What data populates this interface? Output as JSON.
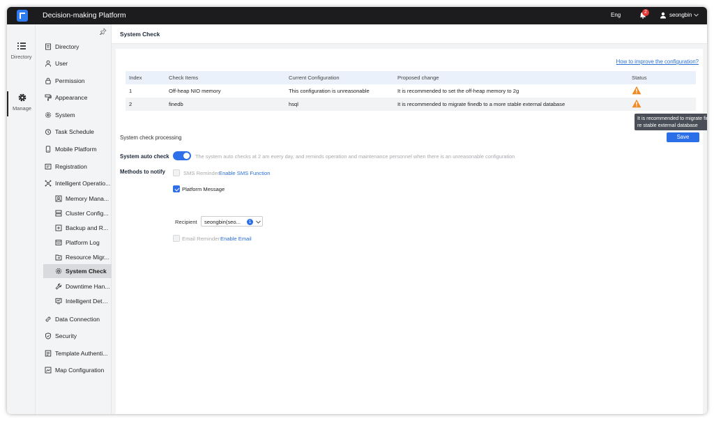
{
  "app": {
    "title": "Decision-making Platform",
    "language": "Eng",
    "notification_count": "2",
    "username": "seongbin"
  },
  "rail": {
    "items": [
      {
        "label": "Directory",
        "icon": "list-icon"
      },
      {
        "label": "Manage",
        "icon": "gear-icon",
        "active": true
      }
    ]
  },
  "nav": {
    "items": [
      {
        "label": "Directory",
        "icon": "book-icon"
      },
      {
        "label": "User",
        "icon": "user-icon"
      },
      {
        "label": "Permission",
        "icon": "lock-icon"
      },
      {
        "label": "Appearance",
        "icon": "paint-icon"
      },
      {
        "label": "System",
        "icon": "gear-icon"
      },
      {
        "label": "Task Schedule",
        "icon": "clock-icon"
      },
      {
        "label": "Mobile Platform",
        "icon": "mobile-icon"
      },
      {
        "label": "Registration",
        "icon": "registration-icon"
      },
      {
        "label": "Intelligent Operatio...",
        "icon": "network-icon"
      }
    ],
    "sub_items": [
      {
        "label": "Memory Mana...",
        "icon": "memory-icon"
      },
      {
        "label": "Cluster Config...",
        "icon": "cluster-icon"
      },
      {
        "label": "Backup and R...",
        "icon": "backup-icon"
      },
      {
        "label": "Platform Log",
        "icon": "log-icon"
      },
      {
        "label": "Resource Migr...",
        "icon": "migration-icon"
      },
      {
        "label": "System Check",
        "icon": "gear-icon",
        "active": true
      },
      {
        "label": "Downtime Han...",
        "icon": "wrench-icon"
      },
      {
        "label": "Intelligent Dete...",
        "icon": "monitor-icon"
      }
    ],
    "bottom_items": [
      {
        "label": "Data Connection",
        "icon": "link-icon"
      },
      {
        "label": "Security",
        "icon": "shield-icon"
      },
      {
        "label": "Template Authenti...",
        "icon": "template-icon"
      },
      {
        "label": "Map Configuration",
        "icon": "map-icon"
      }
    ]
  },
  "page": {
    "title": "System Check",
    "improve_link": "How to improve the configuration?",
    "table": {
      "headers": [
        "Index",
        "Check Items",
        "Current Configuration",
        "Proposed change",
        "Status"
      ],
      "rows": [
        {
          "index": "1",
          "item": "Off-heap NIO memory",
          "config": "This configuration is unreasonable",
          "proposal": "It is recommended to set the off-heap memory to 2g",
          "status": "warning"
        },
        {
          "index": "2",
          "item": "finedb",
          "config": "hsql",
          "proposal": "It is recommended to migrate finedb to a more stable external database",
          "status": "warning"
        }
      ]
    },
    "tooltip": "It is recommended to migrate finedb to a more stable external database",
    "processing_label": "System check processing",
    "save_label": "Save",
    "auto_check_label": "System auto check",
    "auto_check_enabled": true,
    "auto_check_desc": "The system auto checks at 2 am every day, and reminds operation and maintenance personnel when there is an unreasonable configuration",
    "notify_label": "Methods to notify",
    "sms_label": "SMS Reminder",
    "sms_link": "Enable SMS Function",
    "platform_label": "Platform Message",
    "recipient_label": "Recipient",
    "recipient_value": "seongbin(seo...",
    "recipient_count": "1",
    "email_label": "Email Reminder",
    "email_link": "Enable Email"
  },
  "colors": {
    "accent": "#2f6fe8",
    "warning": "#f08a24",
    "topbar": "#1c1c1e"
  }
}
